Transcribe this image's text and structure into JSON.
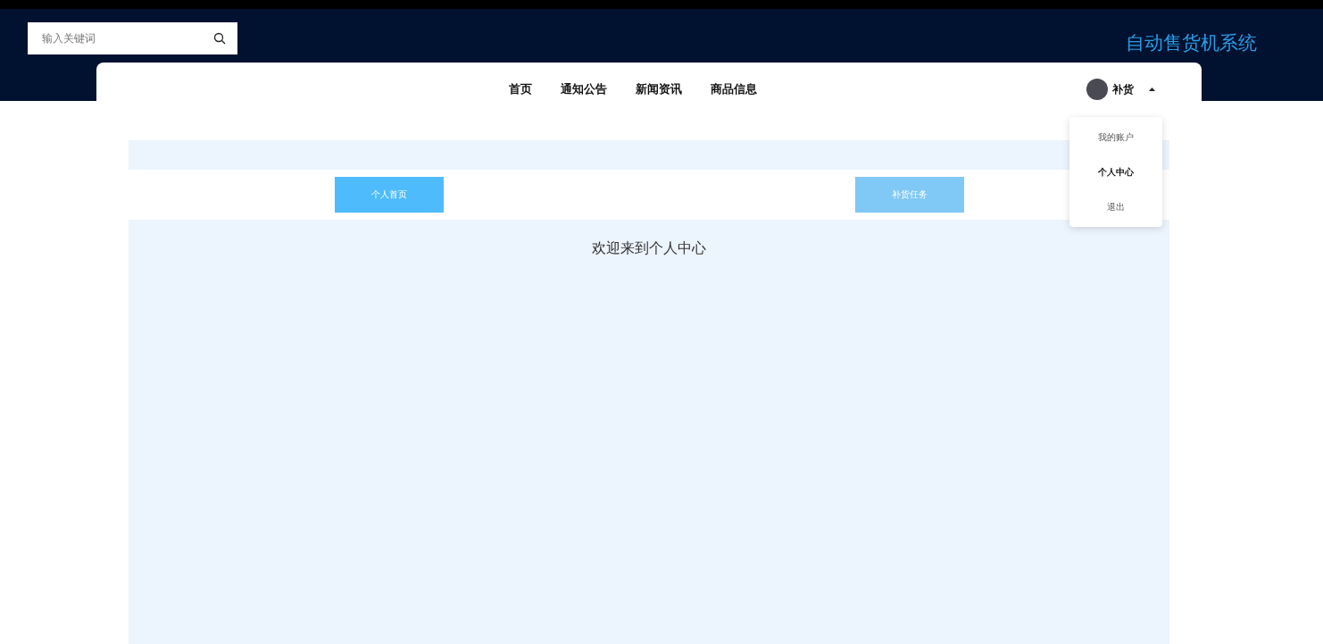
{
  "search": {
    "placeholder": "输入关键词"
  },
  "site_title": "自动售货机系统",
  "nav": [
    {
      "label": "首页"
    },
    {
      "label": "通知公告"
    },
    {
      "label": "新闻资讯"
    },
    {
      "label": "商品信息"
    }
  ],
  "user": {
    "name": "补货",
    "expanded": true
  },
  "user_menu": [
    {
      "label": "我的账户",
      "selected": false
    },
    {
      "label": "个人中心",
      "selected": true
    },
    {
      "label": "退出",
      "selected": false
    }
  ],
  "tabs": [
    {
      "label": "个人首页",
      "selected": true
    },
    {
      "label": "补货任务",
      "selected": false
    }
  ],
  "welcome": "欢迎来到个人中心"
}
